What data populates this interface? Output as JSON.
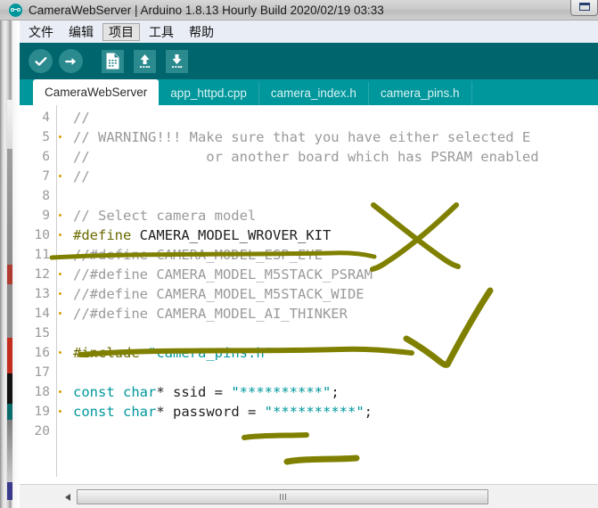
{
  "window": {
    "title": "CameraWebServer | Arduino 1.8.13 Hourly Build 2020/02/19 03:33",
    "icon": "arduino-infinity-icon",
    "restore_button": "restore-button"
  },
  "menubar": {
    "items": [
      {
        "label": "文件",
        "name": "menu-file",
        "active": false
      },
      {
        "label": "编辑",
        "name": "menu-edit",
        "active": false
      },
      {
        "label": "项目",
        "name": "menu-sketch",
        "active": true
      },
      {
        "label": "工具",
        "name": "menu-tools",
        "active": false
      },
      {
        "label": "帮助",
        "name": "menu-help",
        "active": false
      }
    ]
  },
  "toolbar": {
    "background": "#00656c",
    "buttons": [
      {
        "name": "verify-button",
        "icon": "checkmark-circle-icon"
      },
      {
        "name": "upload-button",
        "icon": "arrow-right-circle-icon"
      },
      {
        "name": "new-button",
        "icon": "new-document-icon"
      },
      {
        "name": "open-button",
        "icon": "open-arrow-up-icon"
      },
      {
        "name": "save-button",
        "icon": "save-arrow-down-icon"
      }
    ]
  },
  "tabs": {
    "items": [
      {
        "label": "CameraWebServer",
        "active": true
      },
      {
        "label": "app_httpd.cpp",
        "active": false
      },
      {
        "label": "camera_index.h",
        "active": false
      },
      {
        "label": "camera_pins.h",
        "active": false
      }
    ]
  },
  "editor": {
    "first_line": 4,
    "lines": [
      {
        "n": 4,
        "tokens": [
          {
            "t": "//",
            "c": "cmt"
          }
        ]
      },
      {
        "n": 5,
        "tokens": [
          {
            "t": "// WARNING!!! Make sure that you have either selected E",
            "c": "cmt"
          }
        ]
      },
      {
        "n": 6,
        "tokens": [
          {
            "t": "//              or another board which has PSRAM enabled",
            "c": "cmt"
          }
        ]
      },
      {
        "n": 7,
        "tokens": [
          {
            "t": "//",
            "c": "cmt"
          }
        ]
      },
      {
        "n": 8,
        "tokens": []
      },
      {
        "n": 9,
        "tokens": [
          {
            "t": "// Select camera model",
            "c": "cmt"
          }
        ]
      },
      {
        "n": 10,
        "tokens": [
          {
            "t": "#define",
            "c": "pre"
          },
          {
            "t": " CAMERA_MODEL_WROVER_KIT",
            "c": "op"
          }
        ]
      },
      {
        "n": 11,
        "tokens": [
          {
            "t": "//#define CAMERA_MODEL_ESP_EYE",
            "c": "cmt"
          }
        ]
      },
      {
        "n": 12,
        "tokens": [
          {
            "t": "//#define CAMERA_MODEL_M5STACK_PSRAM",
            "c": "cmt"
          }
        ]
      },
      {
        "n": 13,
        "tokens": [
          {
            "t": "//#define CAMERA_MODEL_M5STACK_WIDE",
            "c": "cmt"
          }
        ]
      },
      {
        "n": 14,
        "tokens": [
          {
            "t": "//#define CAMERA_MODEL_AI_THINKER",
            "c": "cmt"
          }
        ]
      },
      {
        "n": 15,
        "tokens": []
      },
      {
        "n": 16,
        "tokens": [
          {
            "t": "#include",
            "c": "pre"
          },
          {
            "t": " ",
            "c": "op"
          },
          {
            "t": "\"camera_pins.h\"",
            "c": "str"
          }
        ]
      },
      {
        "n": 17,
        "tokens": []
      },
      {
        "n": 18,
        "tokens": [
          {
            "t": "const",
            "c": "kw"
          },
          {
            "t": " ",
            "c": "op"
          },
          {
            "t": "char",
            "c": "kw"
          },
          {
            "t": "* ssid = ",
            "c": "op"
          },
          {
            "t": "\"**********\"",
            "c": "str"
          },
          {
            "t": ";",
            "c": "op"
          }
        ]
      },
      {
        "n": 19,
        "tokens": [
          {
            "t": "const",
            "c": "kw"
          },
          {
            "t": " ",
            "c": "op"
          },
          {
            "t": "char",
            "c": "kw"
          },
          {
            "t": "* password = ",
            "c": "op"
          },
          {
            "t": "\"**********\"",
            "c": "str"
          },
          {
            "t": ";",
            "c": "op"
          }
        ]
      },
      {
        "n": 20,
        "tokens": []
      }
    ]
  },
  "annotations": {
    "color": "#808000",
    "marks": [
      {
        "name": "annotation-cross-mark",
        "kind": "x-cross"
      },
      {
        "name": "annotation-check-mark",
        "kind": "checkmark"
      },
      {
        "name": "annotation-underline-wrover-kit",
        "kind": "underline"
      },
      {
        "name": "annotation-underline-ai-thinker",
        "kind": "underline"
      },
      {
        "name": "annotation-underline-ssid",
        "kind": "underline"
      },
      {
        "name": "annotation-underline-password",
        "kind": "underline"
      }
    ]
  },
  "scrollbar": {
    "left_arrow": "scroll-left-arrow",
    "thumb": "horizontal-scroll-thumb"
  },
  "colors": {
    "toolbar_bg": "#00656c",
    "tab_bg": "#00979c",
    "keyword": "#00979c",
    "comment": "#9a9a9a",
    "preprocessor": "#6a6a00",
    "annotation": "#808000"
  }
}
